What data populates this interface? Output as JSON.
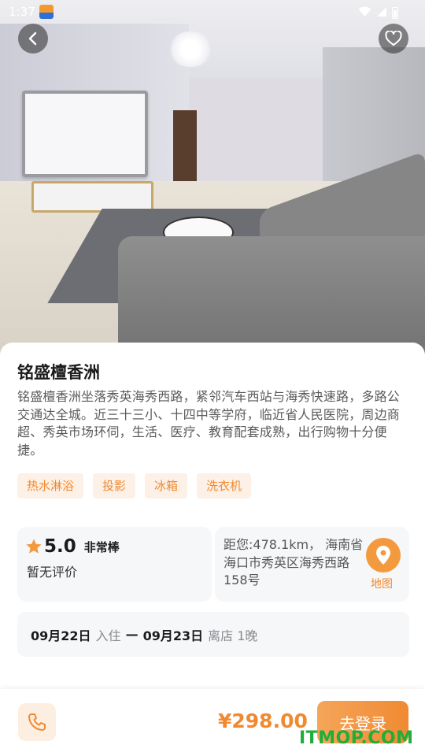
{
  "status_bar": {
    "time": "1:37",
    "app_icon": "app-notification-icon",
    "wifi_icon": "wifi-icon",
    "signal_icon": "signal-icon",
    "battery_icon": "battery-icon"
  },
  "hero": {
    "photo": "living-room-photo",
    "back_icon": "back-arrow-icon",
    "favorite_icon": "heart-icon"
  },
  "listing": {
    "title": "铭盛檀香洲",
    "description": "铭盛檀香洲坐落秀英海秀西路，紧邻汽车西站与海秀快速路，多路公交通达全城。近三十三小、十四中等学府，临近省人民医院，周边商超、秀英市场环伺，生活、医疗、教育配套成熟，出行购物十分便捷。",
    "tags": [
      "热水淋浴",
      "投影",
      "冰箱",
      "洗衣机"
    ]
  },
  "rating": {
    "score": "5.0",
    "label": "非常棒",
    "reviews": "暂无评价",
    "star_icon": "star-icon"
  },
  "location": {
    "text": "距您:478.1km， 海南省海口市秀英区海秀西路158号",
    "map_label": "地图",
    "map_icon": "map-pin-icon"
  },
  "stay": {
    "checkin_date": "09月22日",
    "checkin_label": "入住",
    "separator": "—",
    "checkout_date": "09月23日",
    "checkout_label": "离店 1晚"
  },
  "bottom_bar": {
    "phone_icon": "phone-icon",
    "price": "¥298.00",
    "login_label": "去登录"
  },
  "watermark": "ITMOP.COM",
  "colors": {
    "accent": "#f0892f",
    "tag_bg": "#fdf1e7",
    "card_bg": "#f6f7f9"
  }
}
